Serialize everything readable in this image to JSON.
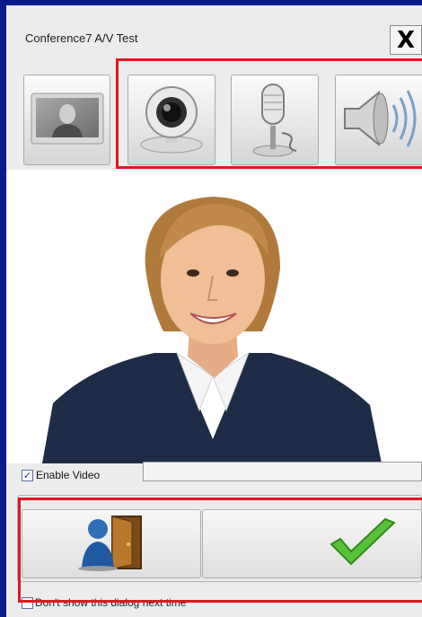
{
  "dialog": {
    "title": "Conference7 A/V Test",
    "close_glyph": "X"
  },
  "toolbar": {
    "items": [
      {
        "name": "video-preview",
        "icon": "user-monitor-icon",
        "selected": false
      },
      {
        "name": "camera",
        "icon": "webcam-icon",
        "selected": true
      },
      {
        "name": "microphone",
        "icon": "microphone-icon",
        "selected": false
      },
      {
        "name": "speaker",
        "icon": "speaker-icon",
        "selected": false
      }
    ]
  },
  "preview": {
    "description_icon": "camera-preview-person"
  },
  "options": {
    "enable_video_label": "Enable Video",
    "enable_video_checked": true,
    "dont_show_label": "Don't show this dialog next time",
    "dont_show_checked": false
  },
  "actions": {
    "exit_icon": "exit-door-icon",
    "ok_icon": "checkmark-icon"
  },
  "colors": {
    "highlight_frame": "#e3161c",
    "window_border": "#0a1a8a",
    "ok_green": "#4bb82d"
  }
}
